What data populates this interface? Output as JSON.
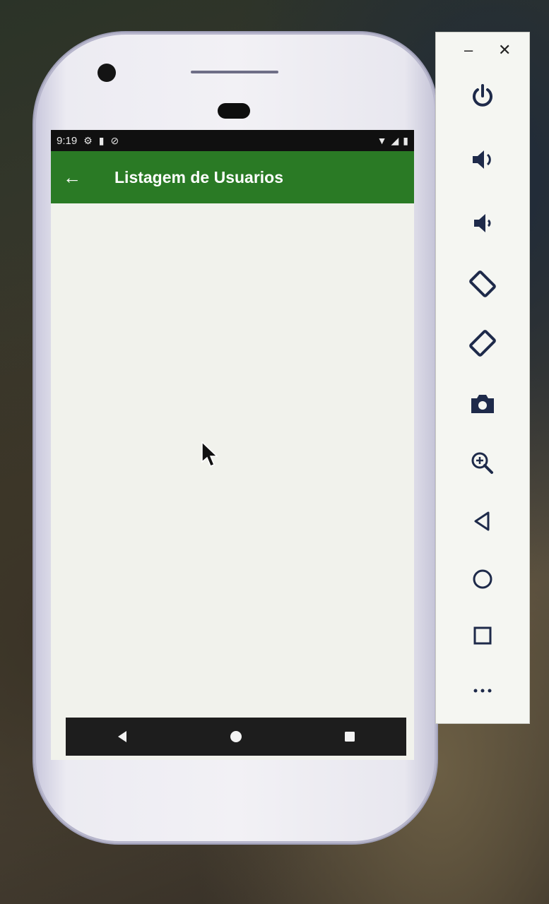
{
  "statusbar": {
    "time": "9:19",
    "left_icons": [
      "settings-icon",
      "sd-card-icon",
      "blocked-icon"
    ],
    "right_icons": [
      "wifi-icon",
      "signal-icon",
      "battery-icon"
    ]
  },
  "appbar": {
    "title": "Listagem de Usuarios",
    "back_icon": "arrow-back-icon",
    "color": "#2a7a25"
  },
  "navbar": {
    "items": [
      "back-triangle-icon",
      "home-circle-icon",
      "recents-square-icon"
    ]
  },
  "emulator_toolbar": {
    "window_controls": {
      "minimize": "–",
      "close": "✕"
    },
    "buttons": [
      "power-icon",
      "volume-up-icon",
      "volume-down-icon",
      "rotate-left-icon",
      "rotate-right-icon",
      "camera-icon",
      "zoom-icon",
      "back-icon",
      "home-icon",
      "overview-icon",
      "more-icon"
    ]
  }
}
